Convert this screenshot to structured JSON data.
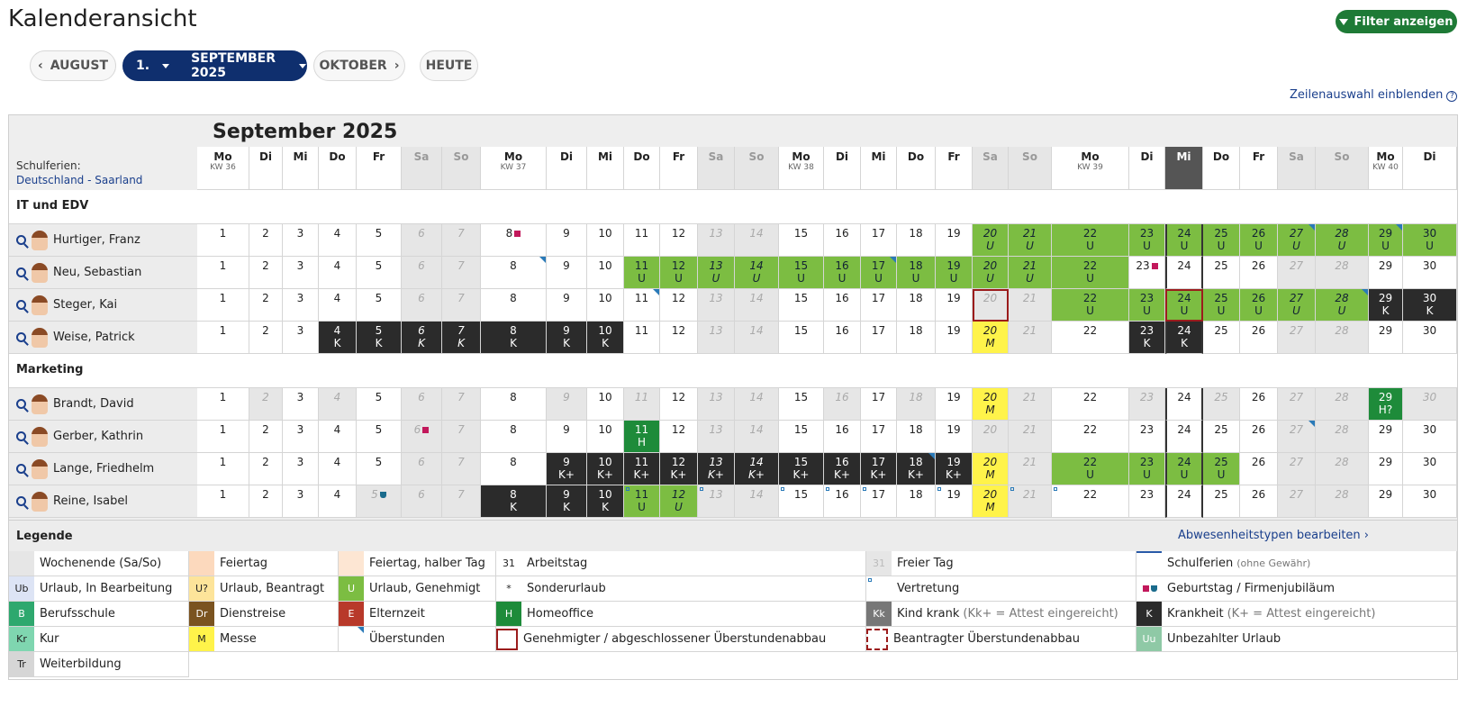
{
  "page_title": "Kalenderansicht",
  "filter_label": "Filter anzeigen",
  "nav": {
    "prev": "AUGUST",
    "day": "1.",
    "month": "SEPTEMBER 2025",
    "next": "OKTOBER",
    "today": "HEUTE"
  },
  "row_select_label": "Zeilenauswahl einblenden",
  "calendar": {
    "title": "September 2025",
    "ferien_label": "Schulferien:",
    "ferien_region": "Deutschland - Saarland",
    "days": [
      {
        "d": "Mo",
        "kw": "KW 36"
      },
      {
        "d": "Di"
      },
      {
        "d": "Mi"
      },
      {
        "d": "Do"
      },
      {
        "d": "Fr"
      },
      {
        "d": "Sa",
        "we": true
      },
      {
        "d": "So",
        "we": true
      },
      {
        "d": "Mo",
        "kw": "KW 37"
      },
      {
        "d": "Di"
      },
      {
        "d": "Mi"
      },
      {
        "d": "Do"
      },
      {
        "d": "Fr"
      },
      {
        "d": "Sa",
        "we": true
      },
      {
        "d": "So",
        "we": true
      },
      {
        "d": "Mo",
        "kw": "KW 38"
      },
      {
        "d": "Di"
      },
      {
        "d": "Mi"
      },
      {
        "d": "Do"
      },
      {
        "d": "Fr"
      },
      {
        "d": "Sa",
        "we": true
      },
      {
        "d": "So",
        "we": true
      },
      {
        "d": "Mo",
        "kw": "KW 39"
      },
      {
        "d": "Di"
      },
      {
        "d": "Mi",
        "today": true
      },
      {
        "d": "Do"
      },
      {
        "d": "Fr"
      },
      {
        "d": "Sa",
        "we": true
      },
      {
        "d": "So",
        "we": true
      },
      {
        "d": "Mo",
        "kw": "KW 40"
      },
      {
        "d": "Di"
      }
    ],
    "groups": [
      {
        "name": "IT und EDV",
        "people": [
          {
            "name": "Hurtiger, Franz",
            "cells": {
              "8": {
                "gift": true
              },
              "20": {
                "c": "g",
                "s": "U",
                "i": true
              },
              "21": {
                "c": "g",
                "s": "U",
                "i": true
              },
              "22": {
                "c": "g",
                "s": "U"
              },
              "23": {
                "c": "g",
                "s": "U"
              },
              "24": {
                "c": "g",
                "s": "U"
              },
              "25": {
                "c": "g",
                "s": "U"
              },
              "26": {
                "c": "g",
                "s": "U"
              },
              "27": {
                "c": "g",
                "s": "U",
                "i": true,
                "corner": true
              },
              "28": {
                "c": "g",
                "s": "U",
                "i": true
              },
              "29": {
                "c": "g",
                "s": "U",
                "corner": true
              },
              "30": {
                "c": "g",
                "s": "U"
              }
            }
          },
          {
            "name": "Neu, Sebastian",
            "cells": {
              "8": {
                "corner": true
              },
              "11": {
                "c": "g",
                "s": "U"
              },
              "12": {
                "c": "g",
                "s": "U"
              },
              "13": {
                "c": "g",
                "s": "U",
                "i": true
              },
              "14": {
                "c": "g",
                "s": "U",
                "i": true
              },
              "15": {
                "c": "g",
                "s": "U"
              },
              "16": {
                "c": "g",
                "s": "U"
              },
              "17": {
                "c": "g",
                "s": "U",
                "corner": true
              },
              "18": {
                "c": "g",
                "s": "U"
              },
              "19": {
                "c": "g",
                "s": "U"
              },
              "20": {
                "c": "g",
                "s": "U",
                "i": true
              },
              "21": {
                "c": "g",
                "s": "U",
                "i": true
              },
              "22": {
                "c": "g",
                "s": "U"
              },
              "23": {
                "gift": true
              }
            }
          },
          {
            "name": "Steger, Kai",
            "cells": {
              "11": {
                "corner": true
              },
              "20": {
                "sel": true
              },
              "22": {
                "c": "g",
                "s": "U"
              },
              "23": {
                "c": "g",
                "s": "U"
              },
              "24": {
                "c": "g",
                "s": "U",
                "sel": true
              },
              "25": {
                "c": "g",
                "s": "U"
              },
              "26": {
                "c": "g",
                "s": "U"
              },
              "27": {
                "c": "g",
                "s": "U",
                "i": true
              },
              "28": {
                "c": "g",
                "s": "U",
                "i": true,
                "corner": true
              },
              "29": {
                "c": "dk",
                "s": "K"
              },
              "30": {
                "c": "dk",
                "s": "K"
              }
            }
          },
          {
            "name": "Weise, Patrick",
            "cells": {
              "4": {
                "c": "dk",
                "s": "K"
              },
              "5": {
                "c": "dk",
                "s": "K"
              },
              "6": {
                "c": "dk",
                "s": "K",
                "i": true
              },
              "7": {
                "c": "dk",
                "s": "K",
                "i": true
              },
              "8": {
                "c": "dk",
                "s": "K"
              },
              "9": {
                "c": "dk",
                "s": "K"
              },
              "10": {
                "c": "dk",
                "s": "K"
              },
              "20": {
                "c": "y",
                "s": "M"
              },
              "23": {
                "c": "dk",
                "s": "K"
              },
              "24": {
                "c": "dk",
                "s": "K"
              }
            }
          }
        ]
      },
      {
        "name": "Marketing",
        "people": [
          {
            "name": "Brandt, David",
            "off": [
              2,
              4,
              9,
              11,
              16,
              18,
              23,
              25,
              30
            ],
            "cells": {
              "20": {
                "c": "y",
                "s": "M"
              },
              "29": {
                "c": "hom",
                "s": "H?"
              }
            }
          },
          {
            "name": "Gerber, Kathrin",
            "cells": {
              "6": {
                "gift": true
              },
              "11": {
                "c": "hom",
                "s": "H"
              },
              "27": {
                "corner": true
              }
            }
          },
          {
            "name": "Lange, Friedhelm",
            "cells": {
              "9": {
                "c": "dk",
                "s": "K+"
              },
              "10": {
                "c": "dk",
                "s": "K+"
              },
              "11": {
                "c": "dk",
                "s": "K+"
              },
              "12": {
                "c": "dk",
                "s": "K+"
              },
              "13": {
                "c": "dk",
                "s": "K+",
                "i": true
              },
              "14": {
                "c": "dk",
                "s": "K+",
                "i": true
              },
              "15": {
                "c": "dk",
                "s": "K+"
              },
              "16": {
                "c": "dk",
                "s": "K+"
              },
              "17": {
                "c": "dk",
                "s": "K+"
              },
              "18": {
                "c": "dk",
                "s": "K+",
                "corner": true
              },
              "19": {
                "c": "dk",
                "s": "K+"
              },
              "20": {
                "c": "y",
                "s": "M"
              },
              "22": {
                "c": "g",
                "s": "U"
              },
              "23": {
                "c": "g",
                "s": "U"
              },
              "24": {
                "c": "g",
                "s": "U"
              },
              "25": {
                "c": "g",
                "s": "U"
              }
            }
          },
          {
            "name": "Reine, Isabel",
            "off": [
              5
            ],
            "cells": {
              "5": {
                "trophy": true
              },
              "8": {
                "c": "dk",
                "s": "K"
              },
              "9": {
                "c": "dk",
                "s": "K"
              },
              "10": {
                "c": "dk",
                "s": "K"
              },
              "11": {
                "c": "g",
                "s": "U",
                "v": true
              },
              "12": {
                "c": "g",
                "s": "U",
                "i": true
              },
              "13": {
                "v": true
              },
              "15": {
                "v": true
              },
              "16": {
                "v": true
              },
              "17": {
                "v": true
              },
              "19": {
                "v": true
              },
              "20": {
                "c": "y",
                "s": "M"
              },
              "21": {
                "v": true
              },
              "22": {
                "v": true
              }
            }
          }
        ]
      }
    ]
  },
  "legend": {
    "title": "Legende",
    "edit": "Abwesenheitstypen bearbeiten ›",
    "rows": [
      [
        {
          "sw": "",
          "bg": "#e6e6e6",
          "label": "Wochenende (Sa/So)"
        },
        {
          "sw": "",
          "bg": "#fcd9bd",
          "label": "Feiertag"
        },
        {
          "sw": "",
          "bg": "#fde6d3",
          "label": "Feiertag, halber Tag"
        },
        {
          "sw": "31",
          "bg": "#fff",
          "label": "Arbeitstag"
        },
        {
          "sw": "31",
          "bg": "#e6e6e6",
          "label": "Freier Tag",
          "swc": "#bbb"
        },
        {
          "sw": "",
          "bg": "#fff",
          "label": "Schulferien",
          "small": "(ohne Gewähr)",
          "line": true
        }
      ],
      [
        {
          "sw": "Ub",
          "bg": "#dde4f5",
          "label": "Urlaub, In Bearbeitung"
        },
        {
          "sw": "U?",
          "bg": "#fde49a",
          "label": "Urlaub, Beantragt"
        },
        {
          "sw": "U",
          "bg": "#7cbd42",
          "label": "Urlaub, Genehmigt",
          "swc": "#fff"
        },
        {
          "sw": "*",
          "bg": "#fff",
          "label": "Sonderurlaub"
        },
        {
          "sw": "",
          "bg": "#fff",
          "label": "Vertretung",
          "vdot": true
        },
        {
          "sw": "",
          "bg": "#fff",
          "label": "Geburtstag / Firmenjubiläum",
          "icons": true
        }
      ],
      [
        {
          "sw": "B",
          "bg": "#2ea86e",
          "label": "Berufsschule",
          "swc": "#fff"
        },
        {
          "sw": "Dr",
          "bg": "#7a5320",
          "label": "Dienstreise",
          "swc": "#fff"
        },
        {
          "sw": "E",
          "bg": "#b8392a",
          "label": "Elternzeit",
          "swc": "#fff"
        },
        {
          "sw": "H",
          "bg": "#1e8b3a",
          "label": "Homeoffice",
          "swc": "#fff"
        },
        {
          "sw": "Kk",
          "bg": "#777",
          "label": "Kind krank",
          "hint": "(Kk+ = Attest eingereicht)",
          "swc": "#fff"
        },
        {
          "sw": "K",
          "bg": "#2b2b2b",
          "label": "Krankheit",
          "hint": "(K+ = Attest eingereicht)",
          "swc": "#fff"
        }
      ],
      [
        {
          "sw": "Kr",
          "bg": "#7fd6b0",
          "label": "Kur"
        },
        {
          "sw": "M",
          "bg": "#fff34a",
          "label": "Messe"
        },
        {
          "sw": "",
          "bg": "#fff",
          "label": "Überstunden",
          "corner": true
        },
        {
          "sw": "",
          "bg": "#fff",
          "label": "Genehmigter / abgeschlossener Überstundenabbau",
          "box": "solid"
        },
        {
          "sw": "",
          "bg": "#fff",
          "label": "Beantragter Überstundenabbau",
          "box": "dashed"
        },
        {
          "sw": "Uu",
          "bg": "#8fc9a6",
          "label": "Unbezahlter Urlaub",
          "swc": "#fff"
        }
      ],
      [
        {
          "sw": "Tr",
          "bg": "#d6d6d6",
          "label": "Weiterbildung"
        }
      ]
    ]
  },
  "colors": {
    "accent": "#0f2f6e",
    "filter": "#1e7a36",
    "vacation": "#7cbd42",
    "sick": "#2b2b2b",
    "fair": "#fff34a"
  }
}
